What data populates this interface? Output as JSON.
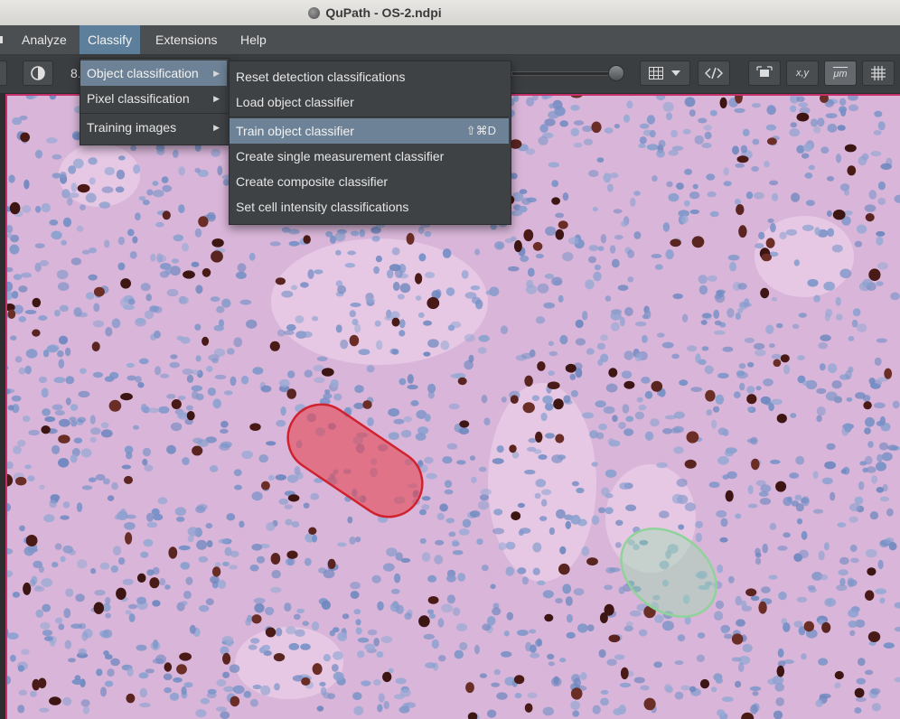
{
  "window": {
    "title": "QuPath - OS-2.ndpi"
  },
  "menubar": {
    "items": [
      "Analyze",
      "Classify",
      "Extensions",
      "Help"
    ],
    "active": "Classify"
  },
  "toolbar": {
    "zoom_text": "8.",
    "coord_label": "x,y",
    "unit_label": "μm"
  },
  "classify_menu": {
    "items": [
      "Object classification",
      "Pixel classification",
      "Training images"
    ]
  },
  "object_classification_menu": {
    "items": [
      "Reset detection classifications",
      "Load object classifier",
      "Train object classifier",
      "Create single measurement classifier",
      "Create composite classifier",
      "Set cell intensity classifications"
    ],
    "highlighted": "Train object classifier",
    "train_shortcut": "⇧⌘D"
  },
  "annotations": [
    {
      "name": "red-annotation",
      "color": "#d9343e"
    },
    {
      "name": "green-annotation",
      "color": "#7fce8a"
    }
  ],
  "icons": [
    "brightness-contrast-icon",
    "table-icon",
    "code-icon",
    "fit-selection-icon",
    "grid-icon"
  ]
}
